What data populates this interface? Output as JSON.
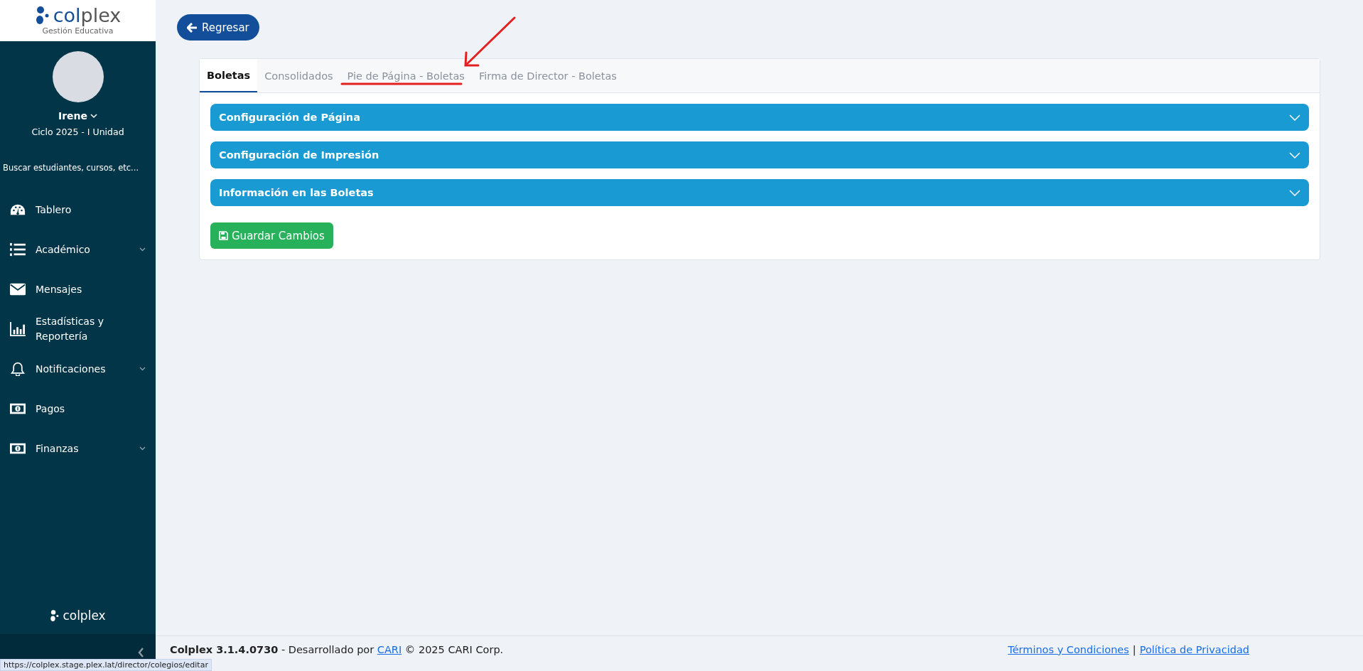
{
  "logo": {
    "brand_first": "col",
    "brand_rest": "plex",
    "tagline": "Gestión Educativa"
  },
  "user": {
    "name": "Irene",
    "cycle": "Ciclo 2025 - I Unidad"
  },
  "search": {
    "placeholder": "Buscar estudiantes, cursos, etc..."
  },
  "nav": [
    {
      "label": "Tablero",
      "expandable": false
    },
    {
      "label": "Académico",
      "expandable": true
    },
    {
      "label": "Mensajes",
      "expandable": false
    },
    {
      "label": "Estadísticas y Reportería",
      "expandable": false
    },
    {
      "label": "Notificaciones",
      "expandable": true
    },
    {
      "label": "Pagos",
      "expandable": false
    },
    {
      "label": "Finanzas",
      "expandable": true
    }
  ],
  "sidebar_footer": {
    "brand": "colplex"
  },
  "back_button": "Regresar",
  "tabs": [
    {
      "label": "Boletas",
      "selected": true
    },
    {
      "label": "Consolidados",
      "selected": false
    },
    {
      "label": "Pie de Página - Boletas",
      "selected": false
    },
    {
      "label": "Firma de Director - Boletas",
      "selected": false
    }
  ],
  "sections": [
    {
      "title": "Configuración de Página",
      "expanded": false
    },
    {
      "title": "Configuración de Impresión",
      "expanded": false
    },
    {
      "title": "Información en las Boletas",
      "expanded": false
    }
  ],
  "save_button": "Guardar Cambios",
  "footer": {
    "product": "Colplex 3.1.4.0730",
    "developed_by": "- Desarrollado por",
    "company_link": "CARI",
    "copyright": "© 2025 CARI Corp.",
    "links": [
      "Términos y Condiciones",
      "Política de Privacidad"
    ],
    "separator": "|"
  },
  "status_url": "https://colplex.stage.plex.lat/director/colegios/editar"
}
